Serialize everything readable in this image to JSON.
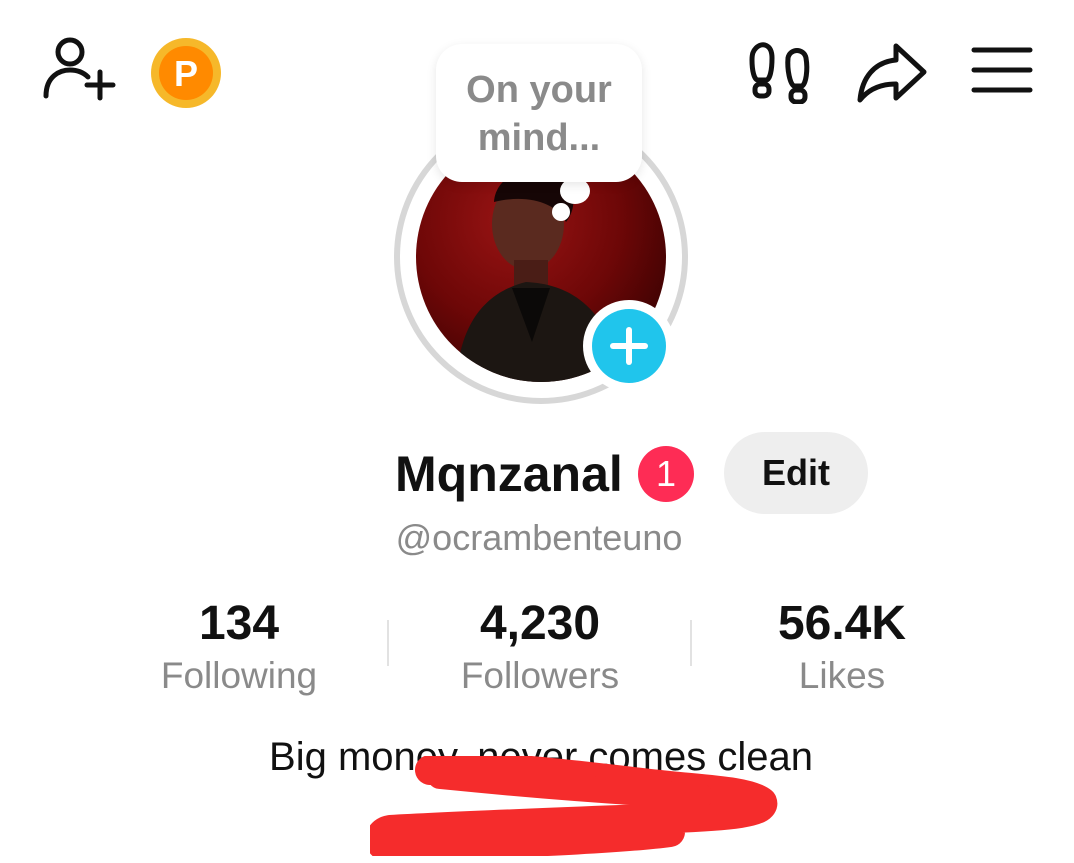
{
  "topbar": {
    "left_icons": [
      "add-friend-icon",
      "coin-icon"
    ],
    "coin_letter": "P",
    "right_icons": [
      "footprint-icon",
      "share-icon",
      "menu-icon"
    ]
  },
  "avatar": {
    "thought_bubble_text": "On your\nmind...",
    "add_story_icon": "plus-icon",
    "accent_color": "#20c5ec"
  },
  "profile": {
    "display_name": "Mqnzanal",
    "notification_badge": "1",
    "badge_color": "#fe2c55",
    "edit_label": "Edit",
    "username": "@ocrambenteuno"
  },
  "stats": [
    {
      "value": "134",
      "label": "Following"
    },
    {
      "value": "4,230",
      "label": "Followers"
    },
    {
      "value": "56.4K",
      "label": "Likes"
    }
  ],
  "bio": {
    "text": "Big money, never comes clean",
    "redaction_color": "#f52c2c"
  }
}
